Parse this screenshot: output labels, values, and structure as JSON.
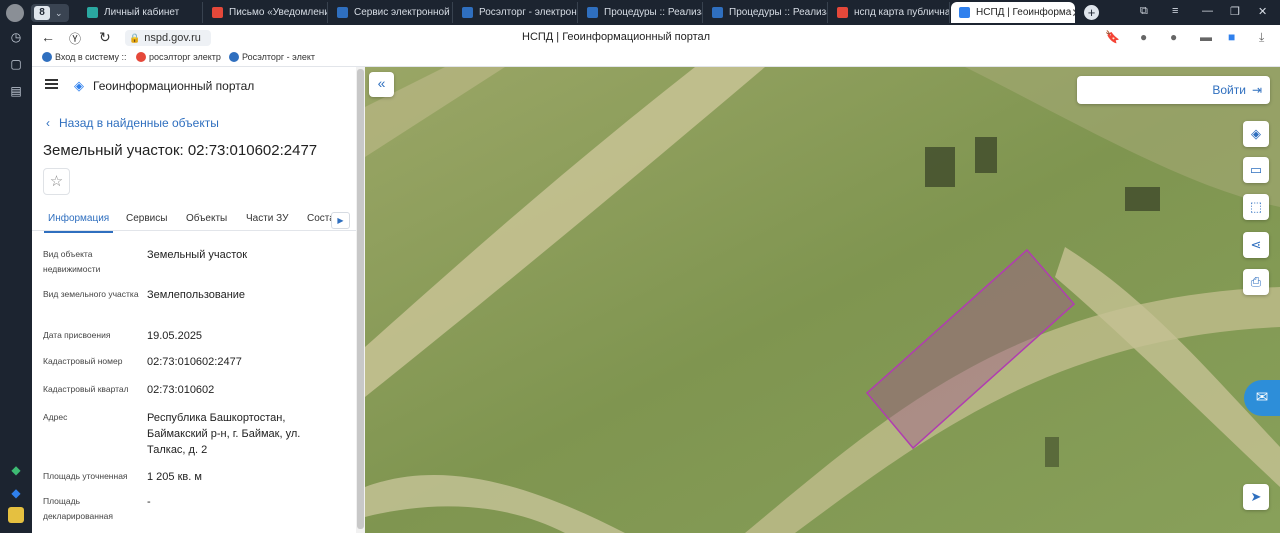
{
  "browser": {
    "tab_count": "8",
    "tabs": [
      {
        "title": "Личный кабинет",
        "favicon_color": "#2aa8a1"
      },
      {
        "title": "Письмо «Уведомление",
        "favicon_color": "#e5483a"
      },
      {
        "title": "Сервис электронной р",
        "favicon_color": "#2f6fbf"
      },
      {
        "title": "Росэлторг - электронна",
        "favicon_color": "#2f6fbf"
      },
      {
        "title": "Процедуры :: Реализац",
        "favicon_color": "#2f6fbf"
      },
      {
        "title": "Процедуры :: Реализац",
        "favicon_color": "#2f6fbf"
      },
      {
        "title": "нспд карта публичная",
        "favicon_color": "#e5483a"
      },
      {
        "title": "НСПД | Геоинформа",
        "favicon_color": "#2f80ed"
      }
    ],
    "close_tab": "✕",
    "url": "nspd.gov.ru",
    "page_title": "НСПД | Геоинформационный портал",
    "bookmarks": [
      {
        "label": "Вход в систему :: ",
        "favicon_color": "#2f6fbf"
      },
      {
        "label": "росэлторг электр",
        "favicon_color": "#e5483a"
      },
      {
        "label": "Росэлторг - элект",
        "favicon_color": "#2f6fbf"
      }
    ]
  },
  "panel": {
    "portal_title": "Геоинформационный портал",
    "back_label": "Назад в найденные объекты",
    "heading": "Земельный участок: 02:73:010602:2477",
    "tabs": [
      "Информация",
      "Сервисы",
      "Объекты",
      "Части ЗУ",
      "Соста"
    ],
    "properties": [
      {
        "key": "Вид объекта недвижимости",
        "value": "Земельный участок"
      },
      {
        "key": "Вид земельного участка",
        "value": "Землепользование"
      },
      {
        "key": "Дата присвоения",
        "value": "19.05.2025"
      },
      {
        "key": "Кадастровый номер",
        "value": "02:73:010602:2477"
      },
      {
        "key": "Кадастровый квартал",
        "value": "02:73:010602"
      },
      {
        "key": "Адрес",
        "value": "Республика Башкортостан, Баймакский р-н, г. Баймак, ул. Талкас, д. 2"
      },
      {
        "key": "Площадь уточненная",
        "value": "1 205 кв. м"
      },
      {
        "key": "Площадь декларированная",
        "value": "-"
      }
    ]
  },
  "map": {
    "login_label": "Войти",
    "parcel_color": "#b03db0",
    "tools": [
      "layers-icon",
      "ruler-icon",
      "select-area-icon",
      "share-icon",
      "print-icon",
      "navigate-icon"
    ]
  }
}
